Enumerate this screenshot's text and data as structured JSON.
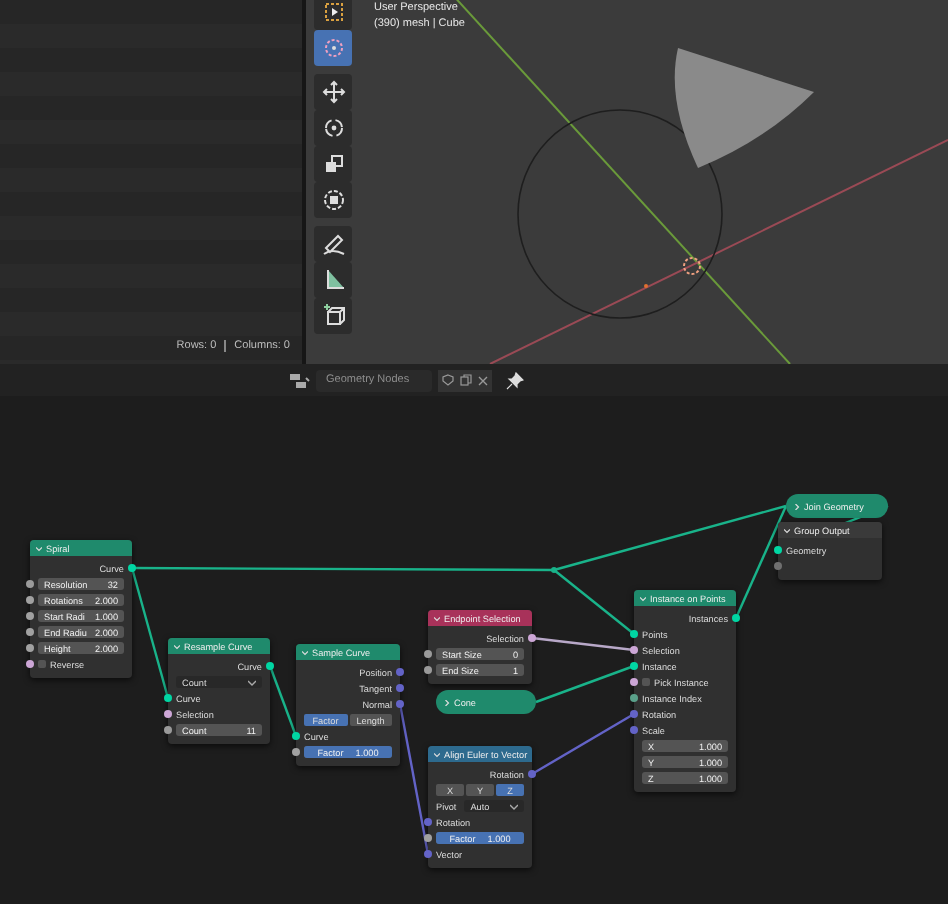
{
  "spreadsheet": {
    "rows": "Rows: 0",
    "columns": "Columns: 0"
  },
  "viewport": {
    "title": "User Perspective",
    "subtitle": "(390) mesh | Cube"
  },
  "toolbar": [
    {
      "selected": false
    },
    {
      "selected": true
    },
    {
      "selected": false
    },
    {
      "selected": false
    },
    {
      "selected": false
    },
    {
      "selected": false
    },
    {
      "selected": false
    },
    {
      "selected": false
    },
    {
      "selected": false
    }
  ],
  "editor_header": {
    "node_tree": "Geometry Nodes"
  },
  "nodes": [
    {
      "kind": "node",
      "title": "Spiral",
      "color": "#1f8a6c",
      "rows": [
        {
          "kind": "output",
          "label": "Curve",
          "color": "#00d6a3"
        },
        {
          "kind": "field",
          "label": "Resolution",
          "value": "32",
          "color": "#9a9a9a"
        },
        {
          "kind": "field",
          "label": "Rotations",
          "value": "2.000",
          "color": "#a1a1a1"
        },
        {
          "kind": "field",
          "label": "Start Radi",
          "value": "1.000",
          "color": "#a1a1a1"
        },
        {
          "kind": "field",
          "label": "End Radiu",
          "value": "2.000",
          "color": "#a1a1a1"
        },
        {
          "kind": "field",
          "label": "Height",
          "value": "2.000",
          "color": "#a1a1a1"
        },
        {
          "kind": "checkbox",
          "label": "Reverse",
          "checked": false,
          "color": "#cca6d6"
        }
      ]
    },
    {
      "kind": "node",
      "title": "Resample Curve",
      "color": "#1f8a6c",
      "rows": [
        {
          "kind": "output",
          "label": "Curve",
          "color": "#00d6a3"
        },
        {
          "kind": "dropdown",
          "value": "Count"
        },
        {
          "kind": "input",
          "label": "Curve",
          "color": "#00d6a3"
        },
        {
          "kind": "input",
          "label": "Selection",
          "color": "#cca6d6"
        },
        {
          "kind": "field",
          "label": "Count",
          "value": "11",
          "color": "#9a9a9a"
        }
      ]
    },
    {
      "kind": "node",
      "title": "Sample Curve",
      "color": "#1f8a6c",
      "rows": [
        {
          "kind": "output",
          "label": "Position",
          "color": "#6363c7"
        },
        {
          "kind": "output",
          "label": "Tangent",
          "color": "#6363c7"
        },
        {
          "kind": "output",
          "label": "Normal",
          "color": "#6363c7"
        },
        {
          "kind": "toggle",
          "options": [
            {
              "label": "Factor",
              "selected": true
            },
            {
              "label": "Length",
              "selected": false
            }
          ]
        },
        {
          "kind": "input",
          "label": "Curve",
          "color": "#00d6a3"
        },
        {
          "kind": "field",
          "label": "Factor",
          "value": "1.000",
          "level": 1,
          "color": "#a1a1a1"
        }
      ]
    },
    {
      "kind": "node",
      "title": "Endpoint Selection",
      "color": "#a8325a",
      "rows": [
        {
          "kind": "output",
          "label": "Selection",
          "color": "#cca6d6"
        },
        {
          "kind": "field",
          "label": "Start Size",
          "value": "0",
          "color": "#9a9a9a"
        },
        {
          "kind": "field",
          "label": "End Size",
          "value": "1",
          "color": "#9a9a9a"
        }
      ]
    },
    {
      "kind": "collapsed",
      "title": "Cone",
      "color": "#1f8a6c"
    },
    {
      "kind": "node",
      "title": "Align Euler to Vector",
      "color": "#2d6a8e",
      "rows": [
        {
          "kind": "output",
          "label": "Rotation",
          "color": "#6363c7"
        },
        {
          "kind": "toggle",
          "options": [
            {
              "label": "X",
              "selected": false
            },
            {
              "label": "Y",
              "selected": false
            },
            {
              "label": "Z",
              "selected": true
            }
          ]
        },
        {
          "kind": "dropdown",
          "label": "Pivot",
          "value": "Auto"
        },
        {
          "kind": "input",
          "label": "Rotation",
          "color": "#6363c7"
        },
        {
          "kind": "field",
          "label": "Factor",
          "value": "1.000",
          "level": 1,
          "color": "#a1a1a1"
        },
        {
          "kind": "input",
          "label": "Vector",
          "color": "#6363c7"
        }
      ]
    },
    {
      "kind": "node",
      "title": "Instance on Points",
      "color": "#1f8a6c",
      "rows": [
        {
          "kind": "output",
          "label": "Instances",
          "color": "#00d6a3"
        },
        {
          "kind": "input",
          "label": "Points",
          "color": "#00d6a3"
        },
        {
          "kind": "input",
          "label": "Selection",
          "color": "#cca6d6"
        },
        {
          "kind": "input",
          "label": "Instance",
          "color": "#00d6a3"
        },
        {
          "kind": "checkbox",
          "label": "Pick Instance",
          "checked": false,
          "color": "#cca6d6"
        },
        {
          "kind": "input",
          "label": "Instance Index",
          "color": "#5aa08a"
        },
        {
          "kind": "input",
          "label": "Rotation",
          "color": "#6363c7"
        },
        {
          "kind": "label",
          "label": "Scale",
          "color": "#6363c7"
        },
        {
          "kind": "field",
          "label": "X",
          "value": "1.000"
        },
        {
          "kind": "field",
          "label": "Y",
          "value": "1.000"
        },
        {
          "kind": "field",
          "label": "Z",
          "value": "1.000"
        }
      ]
    },
    {
      "kind": "collapsed",
      "title": "Join Geometry",
      "color": "#1f8a6c"
    },
    {
      "kind": "node",
      "title": "Group Output",
      "color": "#3a3a3a",
      "rows": [
        {
          "kind": "input",
          "label": "Geometry",
          "color": "#00d6a3"
        },
        {
          "kind": "empty",
          "color": "#6f6f6f"
        }
      ]
    }
  ]
}
